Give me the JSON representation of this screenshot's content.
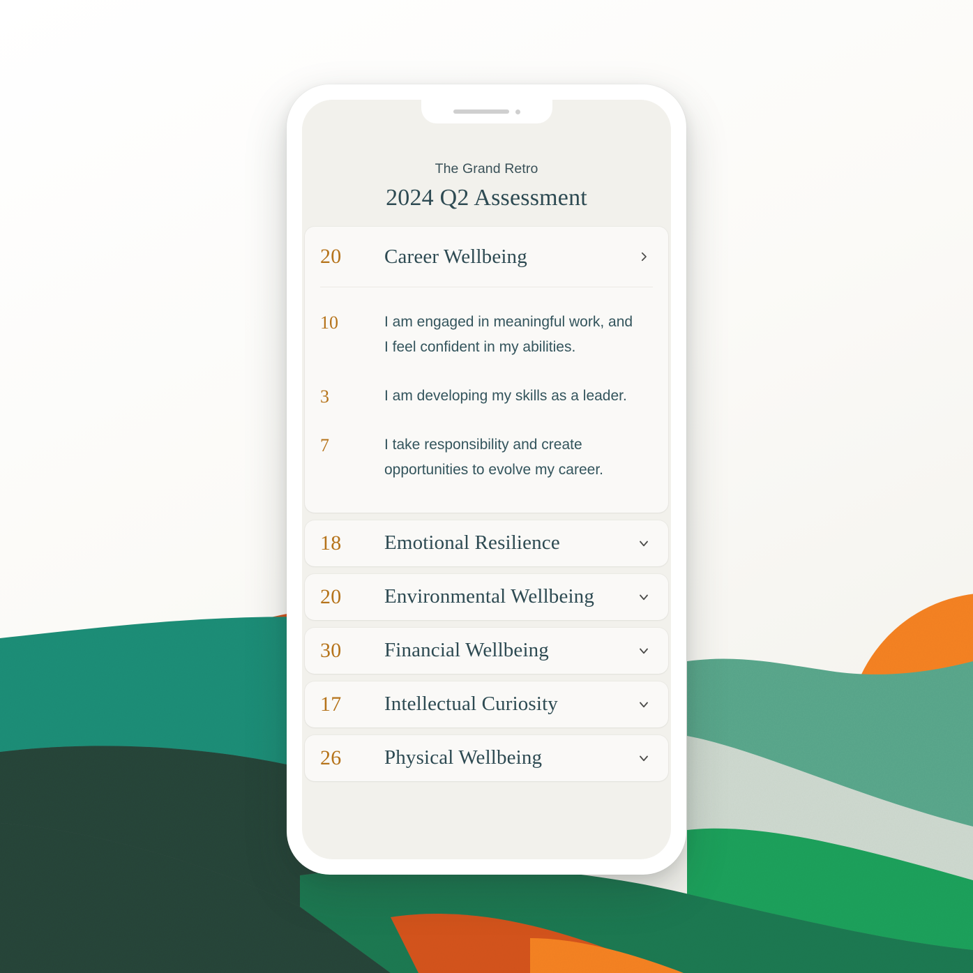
{
  "device": {
    "notch": {
      "speaker": "speaker-grille",
      "camera": "front-camera"
    }
  },
  "header": {
    "brand": "The Grand Retro",
    "title": "2024 Q2 Assessment"
  },
  "expanded_card": {
    "score": "20",
    "name": "Career Wellbeing",
    "chevron": "chevron-right-icon",
    "statements": [
      {
        "score": "10",
        "text": "I am engaged in meaningful work, and I feel confident in my abilities."
      },
      {
        "score": "3",
        "text": "I am developing my skills as a leader."
      },
      {
        "score": "7",
        "text": "I take responsibility and create opportunities to evolve my career."
      }
    ]
  },
  "collapsed_rows": [
    {
      "score": "18",
      "name": "Emotional Resilience",
      "chevron": "chevron-down-icon"
    },
    {
      "score": "20",
      "name": "Environmental Wellbeing",
      "chevron": "chevron-down-icon"
    },
    {
      "score": "30",
      "name": "Financial Wellbeing",
      "chevron": "chevron-down-icon"
    },
    {
      "score": "17",
      "name": "Intellectual Curiosity",
      "chevron": "chevron-down-icon"
    },
    {
      "score": "26",
      "name": "Physical Wellbeing",
      "chevron": "chevron-down-icon"
    }
  ],
  "colors": {
    "accent_score": "#b5731a",
    "text_primary": "#2d4a52",
    "text_body": "#33545c",
    "screen_bg": "#f2f1ec",
    "card_bg": "#faf9f7",
    "device_bezel": "#ffffff",
    "backdrop_cream": "#fbfaf8",
    "art_orange_bright": "#f58220",
    "art_orange_deep": "#d4541e",
    "art_teal": "#1f8f78",
    "art_sage": "#5aa78c",
    "art_pale_sage": "#ced9cf",
    "art_green": "#1fa25c",
    "art_dark_green": "#1c5a42",
    "art_darkest_green": "#27453a"
  }
}
